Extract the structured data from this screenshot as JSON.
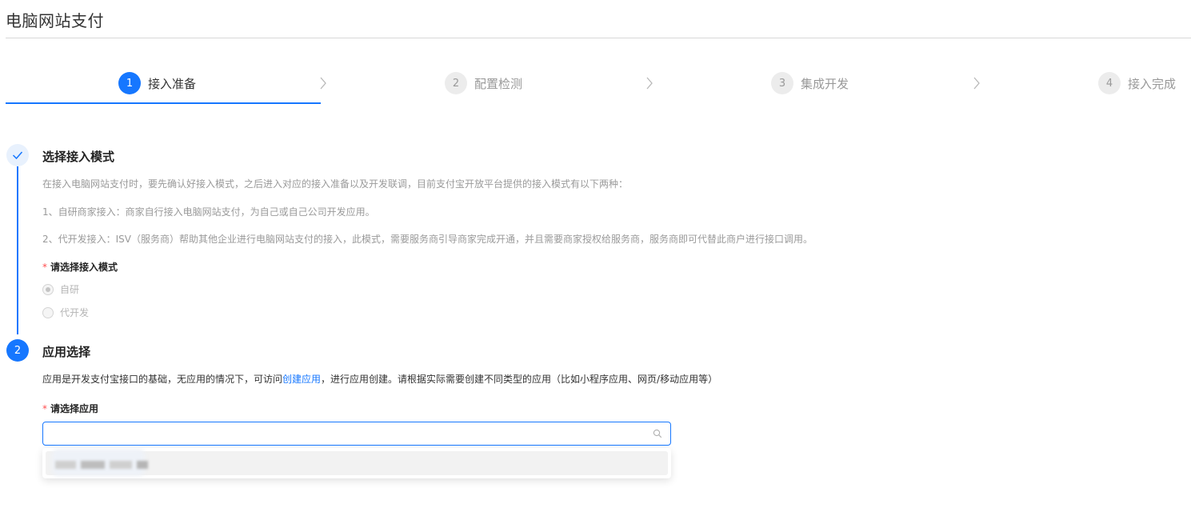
{
  "page": {
    "title": "电脑网站支付"
  },
  "stepper": {
    "steps": [
      {
        "num": "1",
        "label": "接入准备",
        "active": true
      },
      {
        "num": "2",
        "label": "配置检测",
        "active": false
      },
      {
        "num": "3",
        "label": "集成开发",
        "active": false
      },
      {
        "num": "4",
        "label": "接入完成",
        "active": false
      }
    ]
  },
  "section1": {
    "title": "选择接入模式",
    "desc": "在接入电脑网站支付时，要先确认好接入模式，之后进入对应的接入准备以及开发联调，目前支付宝开放平台提供的接入模式有以下两种：",
    "item1": "1、自研商家接入：商家自行接入电脑网站支付，为自己或自己公司开发应用。",
    "item2": "2、代开发接入：ISV（服务商）帮助其他企业进行电脑网站支付的接入，此模式，需要服务商引导商家完成开通，并且需要商家授权给服务商，服务商即可代替此商户进行接口调用。",
    "required_star": "*",
    "field_label": "请选择接入模式",
    "options": [
      {
        "label": "自研",
        "checked": true
      },
      {
        "label": "代开发",
        "checked": false
      }
    ]
  },
  "section2": {
    "num": "2",
    "title": "应用选择",
    "desc_before": "应用是开发支付宝接口的基础，无应用的情况下，可访问",
    "desc_link": "创建应用",
    "desc_after": "，进行应用创建。请根据实际需要创建不同类型的应用（比如小程序应用、网页/移动应用等）",
    "required_star": "*",
    "field_label": "请选择应用",
    "search": {
      "value": "",
      "placeholder": ""
    },
    "dropdown_item_redacted": true
  },
  "colors": {
    "accent": "#1677ff",
    "required": "#ff4d4f"
  },
  "icons": [
    "check-icon",
    "chevron-right-icon",
    "search-icon"
  ]
}
